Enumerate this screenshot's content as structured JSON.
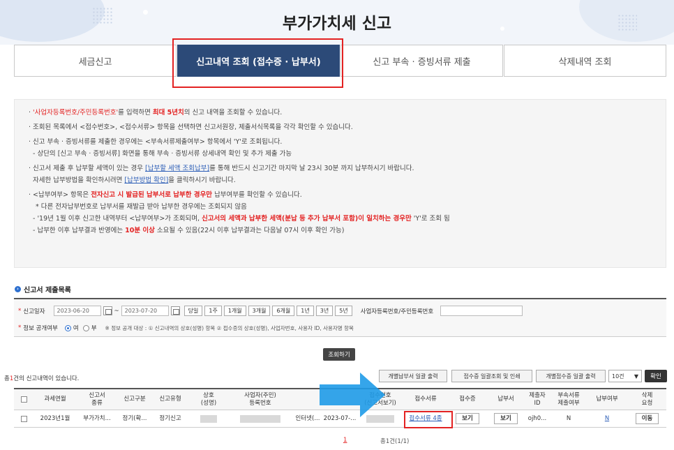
{
  "page_title": "부가가치세 신고",
  "tabs": [
    {
      "label": "세금신고"
    },
    {
      "label": "신고내역 조회 (접수증 · 납부서)"
    },
    {
      "label": "신고 부속 · 증빙서류 제출"
    },
    {
      "label": "삭제내역 조회"
    }
  ],
  "info": {
    "l1a": "· ",
    "l1b": "'사업자등록번호/주민등록번호'",
    "l1c": "를 입력하면 ",
    "l1d": "최대 5년치",
    "l1e": "의 신고 내역을 조회할 수 있습니다.",
    "l2": "· 조회된 목록에서 <접수번호>, <접수서류> 항목을 선택하면 신고서원장, 제출서식목록을 각각 확인할 수 있습니다.",
    "l3": "· 신고 부속 · 증빙서류를 제출한 경우에는 <부속서류제출여부> 항목에서 'Y'로 조회됩니다.",
    "l4": "- 상단의 [신고 부속 · 증빙서류] 화면을 통해 부속 · 증빙서류 상세내역 확인 및 추가 제출 가능",
    "l5a": "· 신고서 제출 후 납부할 세액이 있는 경우 ",
    "l5b": "[납부할 세액 조회납부]",
    "l5c": "를 통해 반드시 신고기간 마지막 날 23시 30분 까지 납부하시기 바랍니다.",
    "l6a": "자세한 납부방법을 확인하시려면 ",
    "l6b": "[납부방법 확인]",
    "l6c": "을 클릭하시기 바랍니다.",
    "l7a": "· <납부여부> 항목은 ",
    "l7b": "전자신고 시 발급된 납부서로 납부한 경우만",
    "l7c": " 납부여부를 확인할 수 있습니다.",
    "l8": "* 다른 전자납부번호로 납부서를 재발급 받아 납부한 경우에는 조회되지 않음",
    "l9a": "- '19년 1월 이후 신고한 내역부터 <납부여부>가 조회되며, ",
    "l9b": "신고서의 세액과 납부한 세액(분납 등 추가 납부서 포함)이 일치하는 경우만",
    "l9c": " 'Y'로 조회 됨",
    "l10a": "- 납부한 이후 납부결과 반영에는 ",
    "l10b": "10분 이상",
    "l10c": " 소요될 수 있음(22시 이후 납부결과는 다음날 07시 이후 확인 가능)"
  },
  "section_title": "신고서 제출목록",
  "form": {
    "date_label": "신고일자",
    "date_from": "2023-06-20",
    "tilde": "~",
    "date_to": "2023-07-20",
    "periods": [
      "당일",
      "1주",
      "1개월",
      "3개월",
      "6개월",
      "1년",
      "3년",
      "5년"
    ],
    "id_label": "사업자등록번호/주민등록번호",
    "open_label": "정보 공개여부",
    "opt_yes": "여",
    "opt_no": "부",
    "open_note": "※ 정보 공개 대상 : ① 신고내역의 상호(성명) 항목 ② 접수증의 상호(성명), 사업자번호, 사용자 ID, 사용자명 항목"
  },
  "search_btn": "조회하기",
  "count_pre": "총",
  "count_num": "1",
  "count_post": "건의 신고내역이 있습니다.",
  "toolbar": {
    "b1": "개별납부서 일괄 출력",
    "b2": "접수증 일괄조회 및 인쇄",
    "b3": "개별접수증 일괄 출력",
    "page_size": "10건",
    "confirm": "확인"
  },
  "columns": [
    "과세연월",
    "신고서\n종류",
    "신고구분",
    "신고유형",
    "상호\n(성명)",
    "사업자(주민)\n등록번호",
    "",
    "접수번호\n(신고서보기)",
    "접수서류",
    "접수증",
    "납부서",
    "제출자\nID",
    "부속서류\n제출여부",
    "납부여부",
    "삭제\n요청"
  ],
  "row": {
    "period": "2023년1월",
    "form_type": "부가가치...",
    "kind": "정기(확...",
    "type": "정기신고",
    "method": "인터넷(...",
    "date": "2023-07-...",
    "docs": "접수서류 4종",
    "receipt": "보기",
    "bill": "보기",
    "submitter": "ojh0...",
    "attached": "N",
    "paid": "N",
    "delete": "이동"
  },
  "pager": {
    "current": "1",
    "summary": "총1건(1/1)"
  }
}
